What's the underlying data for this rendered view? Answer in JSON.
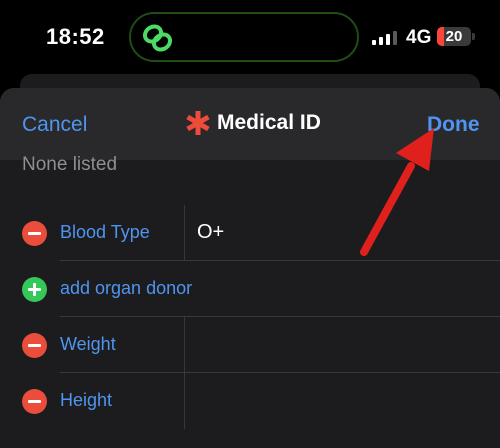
{
  "status_bar": {
    "time": "18:52",
    "network": "4G",
    "battery_level": "20",
    "battery_fraction": 0.2,
    "signal_bars_active": 3,
    "icons": [
      "link-icon",
      "signal-icon",
      "battery-icon"
    ]
  },
  "nav": {
    "cancel_label": "Cancel",
    "title": "Medical ID",
    "done_label": "Done",
    "title_icon": "medical-asterisk-icon"
  },
  "content": {
    "none_listed": "None listed",
    "rows": [
      {
        "type": "remove",
        "label": "Blood Type",
        "value": "O+"
      },
      {
        "type": "add",
        "label": "add organ donor",
        "value": ""
      },
      {
        "type": "remove",
        "label": "Weight",
        "value": ""
      },
      {
        "type": "remove",
        "label": "Height",
        "value": ""
      }
    ]
  },
  "colors": {
    "accent": "#4f95ef",
    "remove": "#eb4d3d",
    "add": "#34c759",
    "asterisk": "#ee4b3b",
    "annotation_arrow": "#e0201c"
  }
}
